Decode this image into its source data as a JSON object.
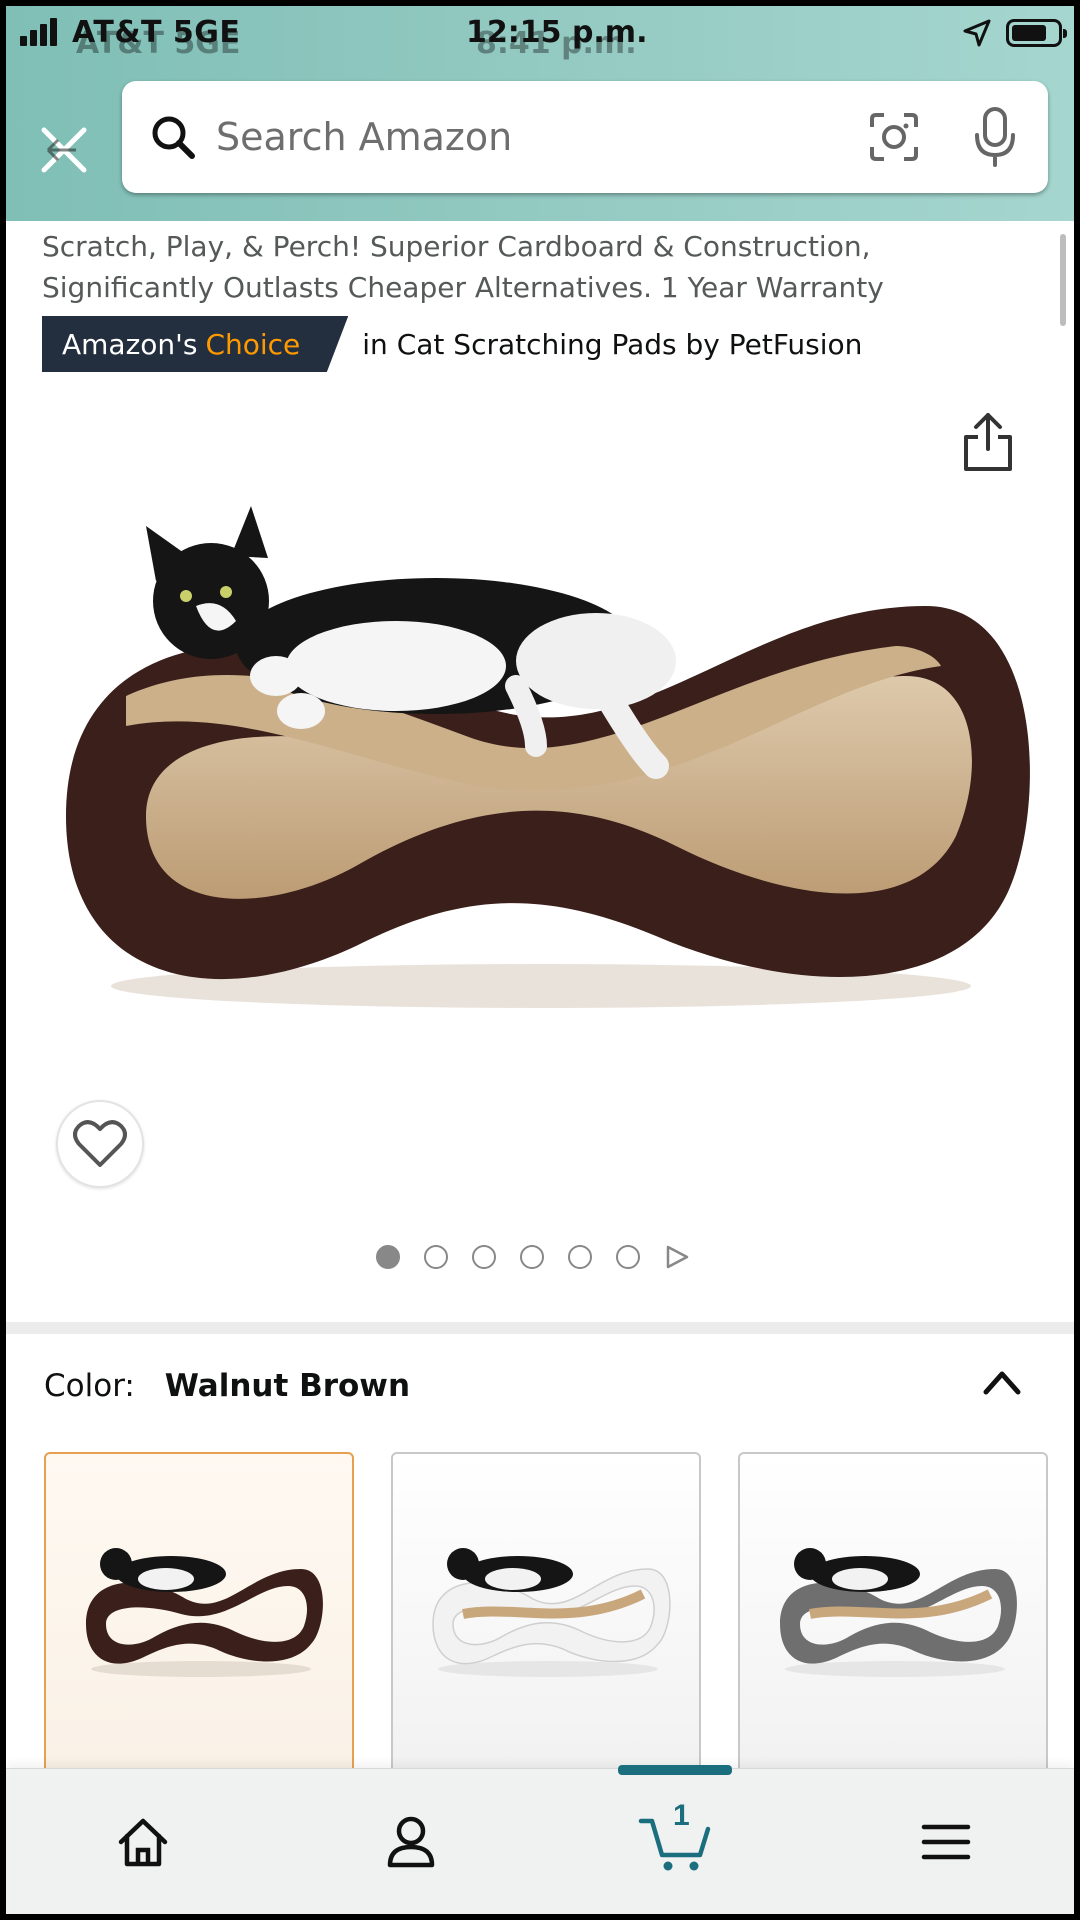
{
  "status_bar": {
    "carrier": "AT&T 5GE",
    "time": "12:15 p.m.",
    "ghost_carrier": "AT&T 5GE",
    "ghost_time": "8:41 p.m."
  },
  "search": {
    "placeholder": "Search Amazon"
  },
  "product": {
    "subtitle_line1": "Scratch, Play, & Perch! Superior Cardboard & Construction,",
    "subtitle_line2": "Significantly Outlasts Cheaper Alternatives. 1 Year Warranty",
    "badge_prefix": "Amazon's",
    "badge_accent": "Choice",
    "badge_text": "in Cat Scratching Pads by PetFusion",
    "image_count": 6,
    "active_image": 1
  },
  "color_selector": {
    "label": "Color:",
    "selected": "Walnut Brown",
    "options": [
      {
        "frame_color": "#3a1f1a",
        "selected": true
      },
      {
        "frame_color": "#f2f2f2",
        "selected": false
      },
      {
        "frame_color": "#6f6f6f",
        "selected": false
      }
    ]
  },
  "bottom_nav": {
    "items": [
      "home-icon",
      "account-icon",
      "cart-icon",
      "menu-icon"
    ],
    "cart_count": "1",
    "active": "cart"
  },
  "colors": {
    "header_teal": "#8fc7bf",
    "badge_navy": "#232f3e",
    "badge_orange": "#ff9900",
    "nav_active": "#1b6e7e",
    "selected_border": "#e7a050"
  }
}
